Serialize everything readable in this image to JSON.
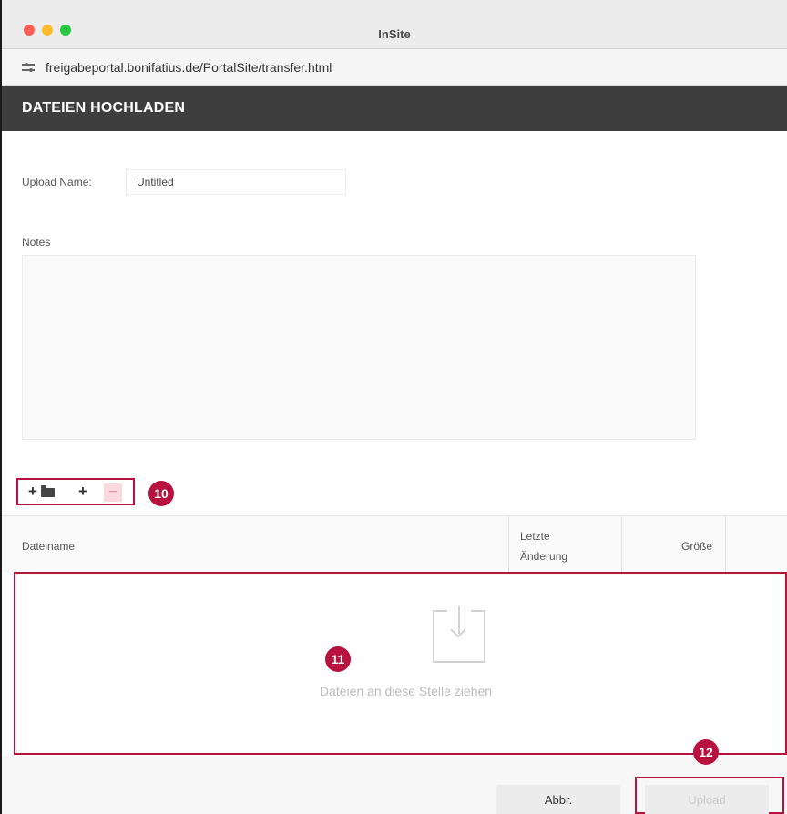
{
  "window": {
    "title": "InSite"
  },
  "browser": {
    "url": "freigabeportal.bonifatius.de/PortalSite/transfer.html"
  },
  "header": {
    "title": "DATEIEN HOCHLADEN"
  },
  "form": {
    "upload_name_label": "Upload Name:",
    "upload_name_value": "Untitled",
    "notes_label": "Notes",
    "notes_value": ""
  },
  "toolbar": {
    "add_folder_icon": "plus-folder-icon",
    "add_file_label": "+",
    "remove_label": "−"
  },
  "table": {
    "columns": [
      "Dateiname",
      "Letzte",
      "Änderung",
      "Größe"
    ]
  },
  "dropzone": {
    "text": "Dateien an diese Stelle ziehen",
    "icon": "download-tray-icon"
  },
  "footer": {
    "cancel_label": "Abbr.",
    "upload_label": "Upload"
  },
  "annotations": {
    "badge_10": "10",
    "badge_11": "11",
    "badge_12": "12"
  },
  "colors": {
    "accent": "#b8123f",
    "header_bg": "#3e3e3e"
  }
}
